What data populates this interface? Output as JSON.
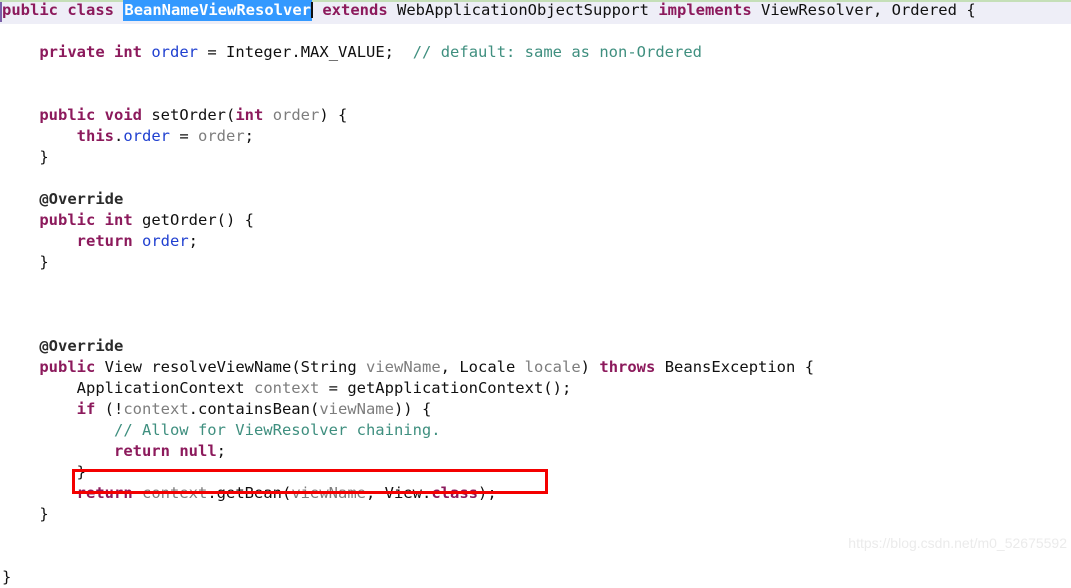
{
  "editor": {
    "language": "java",
    "selection_color": "#3399ff",
    "current_line_color": "#eeeef7",
    "annotation_box_color": "#f40000",
    "comment_color": "#3f8f7f",
    "keyword_color": "#8c1a5c",
    "field_color": "#2040d0",
    "parameter_color": "#7d7d7d"
  },
  "code": {
    "line1": {
      "kw_public": "public",
      "kw_class": "class",
      "selected_class_name": "BeanNameViewResolver",
      "kw_extends": "extends",
      "superclass": "WebApplicationObjectSupport",
      "kw_implements": "implements",
      "interfaces": "ViewResolver, Ordered",
      "open_brace": "{"
    },
    "line2": {
      "kw_private": "private",
      "kw_int": "int",
      "field_name": "order",
      "assign": "=",
      "value": "Integer.MAX_VALUE;",
      "comment": "// default: same as non-Ordered"
    },
    "line_setorder_sig": {
      "kw_public": "public",
      "kw_void": "void",
      "method_name": "setOrder(",
      "kw_int": "int",
      "param": "order",
      "close": ") {"
    },
    "line_setorder_body": {
      "kw_this": "this",
      "dot": ".",
      "field_name": "order",
      "assign": " = ",
      "param": "order",
      "semi": ";"
    },
    "line_setorder_close": "}",
    "line_override_1": "@Override",
    "line_getorder_sig": {
      "kw_public": "public",
      "kw_int": "int",
      "method_name": "getOrder() {"
    },
    "line_getorder_body": {
      "kw_return": "return",
      "field_name": "order",
      "semi": ";"
    },
    "line_getorder_close": "}",
    "line_override_2": "@Override",
    "line_resolve_sig": {
      "kw_public": "public",
      "return_type": "View",
      "method_name": "resolveViewName(",
      "param_type_1": "String",
      "param_1": "viewName",
      "comma": ", ",
      "param_type_2": "Locale",
      "param_2": "locale",
      "close_paren": ")",
      "kw_throws": "throws",
      "exception": "BeansException",
      "open_brace": "{"
    },
    "line_ctx": {
      "type": "ApplicationContext",
      "var": "context",
      "assign": " = ",
      "call": "getApplicationContext();"
    },
    "line_if": {
      "kw_if": "if",
      "open": " (!",
      "var": "context",
      "dot_method": ".containsBean(",
      "arg": "viewName",
      "close": ")) {"
    },
    "line_comment_chaining": "// Allow for ViewResolver chaining.",
    "line_return_null": {
      "kw_return": "return",
      "kw_null": "null",
      "semi": ";"
    },
    "line_if_close": "}",
    "line_boxed_return": {
      "kw_return": "return",
      "var": "context",
      "dot_method": ".getBean(",
      "arg_1": "viewName",
      "comma": ", ",
      "view_type": "View",
      "dot": ".",
      "kw_class": "class",
      "close": ");"
    },
    "line_method_close": "}",
    "line_class_close": "}"
  },
  "watermark": {
    "text": "https://blog.csdn.net/m0_52675592"
  }
}
